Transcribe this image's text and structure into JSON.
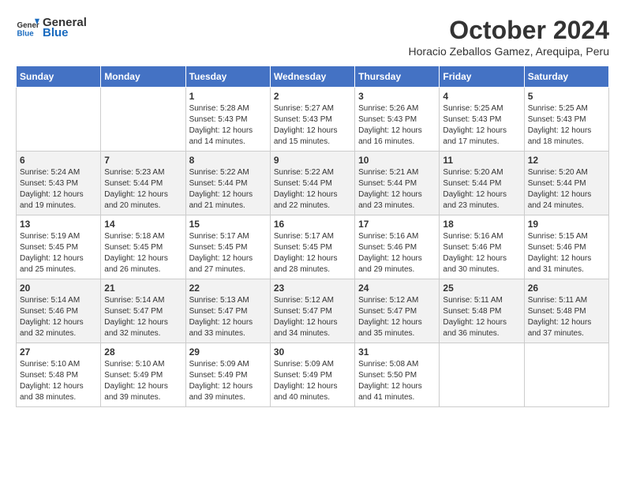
{
  "header": {
    "logo_general": "General",
    "logo_blue": "Blue",
    "month_year": "October 2024",
    "subtitle": "Horacio Zeballos Gamez, Arequipa, Peru"
  },
  "weekdays": [
    "Sunday",
    "Monday",
    "Tuesday",
    "Wednesday",
    "Thursday",
    "Friday",
    "Saturday"
  ],
  "weeks": [
    [
      {
        "day": "",
        "info": ""
      },
      {
        "day": "",
        "info": ""
      },
      {
        "day": "1",
        "info": "Sunrise: 5:28 AM\nSunset: 5:43 PM\nDaylight: 12 hours and 14 minutes."
      },
      {
        "day": "2",
        "info": "Sunrise: 5:27 AM\nSunset: 5:43 PM\nDaylight: 12 hours and 15 minutes."
      },
      {
        "day": "3",
        "info": "Sunrise: 5:26 AM\nSunset: 5:43 PM\nDaylight: 12 hours and 16 minutes."
      },
      {
        "day": "4",
        "info": "Sunrise: 5:25 AM\nSunset: 5:43 PM\nDaylight: 12 hours and 17 minutes."
      },
      {
        "day": "5",
        "info": "Sunrise: 5:25 AM\nSunset: 5:43 PM\nDaylight: 12 hours and 18 minutes."
      }
    ],
    [
      {
        "day": "6",
        "info": "Sunrise: 5:24 AM\nSunset: 5:43 PM\nDaylight: 12 hours and 19 minutes."
      },
      {
        "day": "7",
        "info": "Sunrise: 5:23 AM\nSunset: 5:44 PM\nDaylight: 12 hours and 20 minutes."
      },
      {
        "day": "8",
        "info": "Sunrise: 5:22 AM\nSunset: 5:44 PM\nDaylight: 12 hours and 21 minutes."
      },
      {
        "day": "9",
        "info": "Sunrise: 5:22 AM\nSunset: 5:44 PM\nDaylight: 12 hours and 22 minutes."
      },
      {
        "day": "10",
        "info": "Sunrise: 5:21 AM\nSunset: 5:44 PM\nDaylight: 12 hours and 23 minutes."
      },
      {
        "day": "11",
        "info": "Sunrise: 5:20 AM\nSunset: 5:44 PM\nDaylight: 12 hours and 23 minutes."
      },
      {
        "day": "12",
        "info": "Sunrise: 5:20 AM\nSunset: 5:44 PM\nDaylight: 12 hours and 24 minutes."
      }
    ],
    [
      {
        "day": "13",
        "info": "Sunrise: 5:19 AM\nSunset: 5:45 PM\nDaylight: 12 hours and 25 minutes."
      },
      {
        "day": "14",
        "info": "Sunrise: 5:18 AM\nSunset: 5:45 PM\nDaylight: 12 hours and 26 minutes."
      },
      {
        "day": "15",
        "info": "Sunrise: 5:17 AM\nSunset: 5:45 PM\nDaylight: 12 hours and 27 minutes."
      },
      {
        "day": "16",
        "info": "Sunrise: 5:17 AM\nSunset: 5:45 PM\nDaylight: 12 hours and 28 minutes."
      },
      {
        "day": "17",
        "info": "Sunrise: 5:16 AM\nSunset: 5:46 PM\nDaylight: 12 hours and 29 minutes."
      },
      {
        "day": "18",
        "info": "Sunrise: 5:16 AM\nSunset: 5:46 PM\nDaylight: 12 hours and 30 minutes."
      },
      {
        "day": "19",
        "info": "Sunrise: 5:15 AM\nSunset: 5:46 PM\nDaylight: 12 hours and 31 minutes."
      }
    ],
    [
      {
        "day": "20",
        "info": "Sunrise: 5:14 AM\nSunset: 5:46 PM\nDaylight: 12 hours and 32 minutes."
      },
      {
        "day": "21",
        "info": "Sunrise: 5:14 AM\nSunset: 5:47 PM\nDaylight: 12 hours and 32 minutes."
      },
      {
        "day": "22",
        "info": "Sunrise: 5:13 AM\nSunset: 5:47 PM\nDaylight: 12 hours and 33 minutes."
      },
      {
        "day": "23",
        "info": "Sunrise: 5:12 AM\nSunset: 5:47 PM\nDaylight: 12 hours and 34 minutes."
      },
      {
        "day": "24",
        "info": "Sunrise: 5:12 AM\nSunset: 5:47 PM\nDaylight: 12 hours and 35 minutes."
      },
      {
        "day": "25",
        "info": "Sunrise: 5:11 AM\nSunset: 5:48 PM\nDaylight: 12 hours and 36 minutes."
      },
      {
        "day": "26",
        "info": "Sunrise: 5:11 AM\nSunset: 5:48 PM\nDaylight: 12 hours and 37 minutes."
      }
    ],
    [
      {
        "day": "27",
        "info": "Sunrise: 5:10 AM\nSunset: 5:48 PM\nDaylight: 12 hours and 38 minutes."
      },
      {
        "day": "28",
        "info": "Sunrise: 5:10 AM\nSunset: 5:49 PM\nDaylight: 12 hours and 39 minutes."
      },
      {
        "day": "29",
        "info": "Sunrise: 5:09 AM\nSunset: 5:49 PM\nDaylight: 12 hours and 39 minutes."
      },
      {
        "day": "30",
        "info": "Sunrise: 5:09 AM\nSunset: 5:49 PM\nDaylight: 12 hours and 40 minutes."
      },
      {
        "day": "31",
        "info": "Sunrise: 5:08 AM\nSunset: 5:50 PM\nDaylight: 12 hours and 41 minutes."
      },
      {
        "day": "",
        "info": ""
      },
      {
        "day": "",
        "info": ""
      }
    ]
  ]
}
